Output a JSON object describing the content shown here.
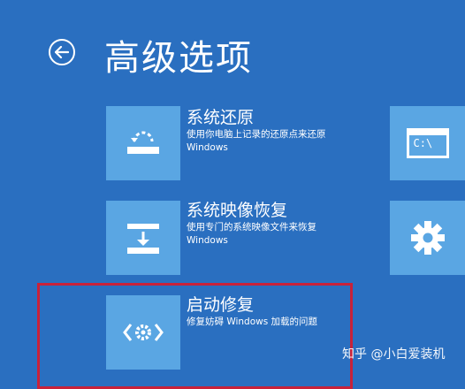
{
  "header": {
    "title": "高级选项"
  },
  "options": [
    {
      "title": "系统还原",
      "desc_line1": "使用你电脑上记录的还原点来还原",
      "desc_line2": "Windows"
    },
    {
      "title": "系统映像恢复",
      "desc_line1": "使用专门的系统映像文件来恢复",
      "desc_line2": "Windows"
    },
    {
      "title": "启动修复",
      "desc_line1": "修复妨碍 Windows 加载的问题"
    }
  ],
  "right_tiles": [
    {
      "icon": "command-prompt-icon",
      "text": "C:\\"
    },
    {
      "icon": "gear-icon"
    }
  ],
  "watermark": "知乎 @小白爱装机",
  "colors": {
    "background": "#2a6fc0",
    "tile": "#5aa6e3",
    "highlight": "#c8223a"
  }
}
